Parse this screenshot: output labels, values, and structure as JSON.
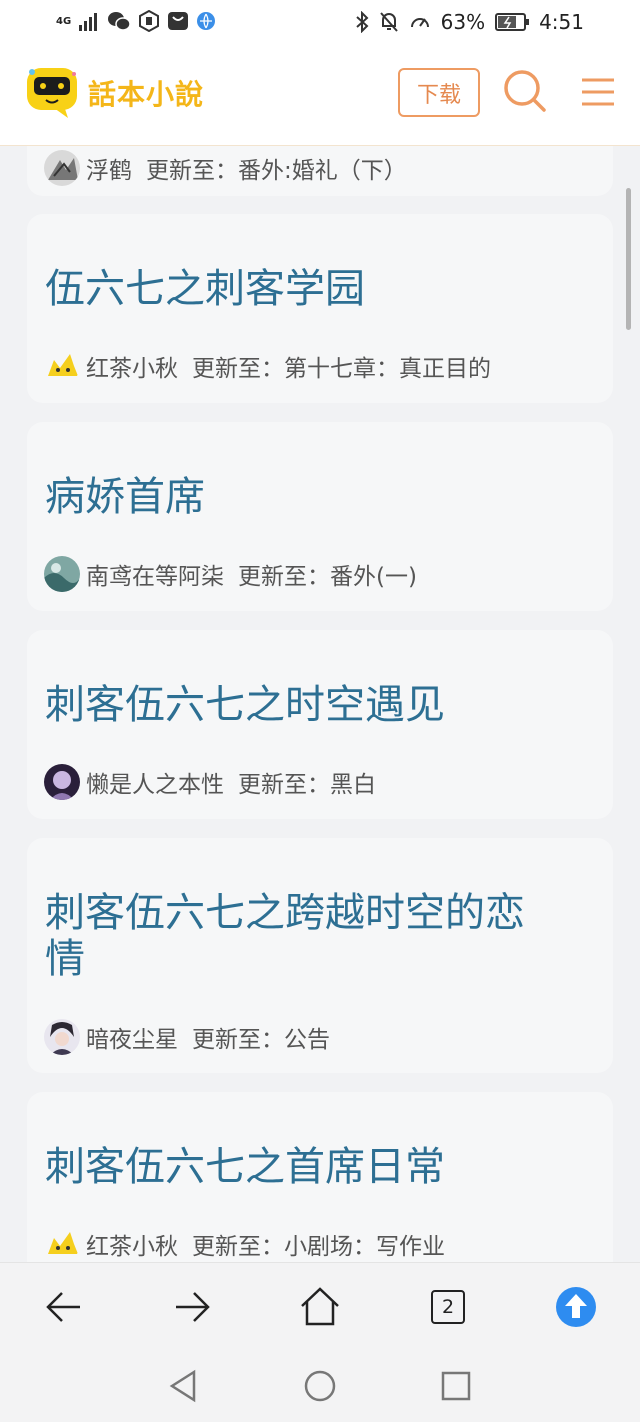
{
  "status_bar": {
    "network": "4G",
    "battery_percent": "63%",
    "time": "4:51"
  },
  "header": {
    "logo_title": "話本小說",
    "download_label": "下载"
  },
  "novels": [
    {
      "author": "浮鹤",
      "update_prefix": "更新至：",
      "update": "番外:婚礼（下）"
    },
    {
      "title": "伍六七之刺客学园",
      "author": "红茶小秋",
      "update_prefix": "更新至：",
      "update": "第十七章：真正目的"
    },
    {
      "title": "病娇首席",
      "author": "南鸢在等阿柒",
      "update_prefix": "更新至：",
      "update": "番外(一)"
    },
    {
      "title": "刺客伍六七之时空遇见",
      "author": "懒是人之本性",
      "update_prefix": "更新至：",
      "update": "黑白"
    },
    {
      "title_line1": "刺客伍六七之跨越时空的恋",
      "title_line2": "情",
      "author": "暗夜尘星",
      "update_prefix": "更新至：",
      "update": "公告"
    },
    {
      "title": "刺客伍六七之首席日常",
      "author": "红茶小秋",
      "update_prefix": "更新至：",
      "update": "小剧场：写作业"
    }
  ],
  "browser_bar": {
    "tab_count": "2"
  },
  "colors": {
    "title": "#2d6f93",
    "accent": "#ee9b62",
    "logo": "#f4b619",
    "upload": "#2e8cf0"
  }
}
